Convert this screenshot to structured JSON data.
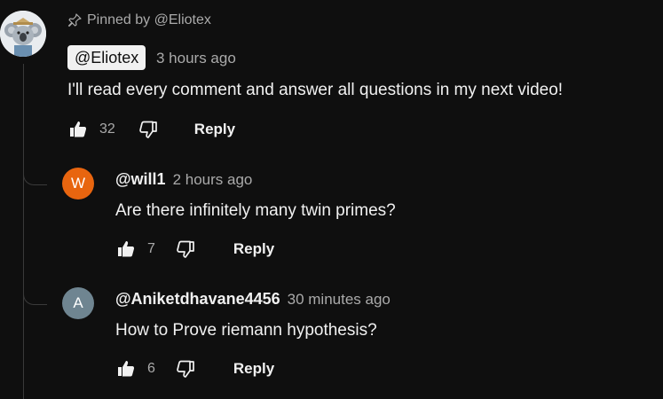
{
  "pinned": {
    "label": "Pinned by @Eliotex"
  },
  "main_comment": {
    "author": "@Eliotex",
    "time": "3 hours ago",
    "text": "I'll read every comment and answer all questions in my next video!",
    "likes": "32",
    "reply_label": "Reply"
  },
  "replies": [
    {
      "avatar_letter": "W",
      "avatar_color": "#e8650f",
      "author": "@will1",
      "time": "2 hours ago",
      "text": "Are there infinitely many twin primes?",
      "likes": "7",
      "reply_label": "Reply"
    },
    {
      "avatar_letter": "A",
      "avatar_color": "#6f8591",
      "author": "@Aniketdhavane4456",
      "time": "30 minutes ago",
      "text": "How to Prove riemann hypothesis?",
      "likes": "6",
      "reply_label": "Reply"
    }
  ],
  "icons": {
    "pin": "pin-icon",
    "like": "thumbs-up-icon",
    "dislike": "thumbs-down-icon",
    "avatar": "koala-avatar-icon"
  }
}
